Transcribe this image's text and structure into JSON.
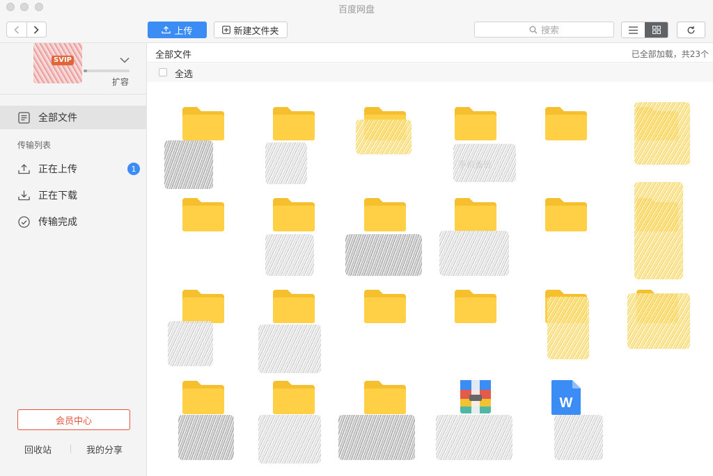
{
  "window": {
    "title": "百度网盘"
  },
  "toolbar": {
    "upload_label": "上传",
    "new_folder_label": "新建文件夹",
    "search_placeholder": "搜索"
  },
  "sidebar": {
    "vip_badge": "SVIP",
    "expand_label": "扩容",
    "all_files_label": "全部文件",
    "transfer_section_label": "传输列表",
    "transfer_items": [
      {
        "label": "正在上传",
        "icon": "upload-icon",
        "badge": "1"
      },
      {
        "label": "正在下载",
        "icon": "download-icon"
      },
      {
        "label": "传输完成",
        "icon": "check-circle-icon"
      }
    ],
    "vip_center_label": "会员中心",
    "recycle_label": "回收站",
    "my_share_label": "我的分享"
  },
  "main": {
    "breadcrumb": "全部文件",
    "load_status": "已全部加载，共23个",
    "select_all_label": "全选",
    "items": [
      {
        "type": "folder",
        "name": ""
      },
      {
        "type": "folder",
        "name": ""
      },
      {
        "type": "folder",
        "name": ""
      },
      {
        "type": "folder",
        "name": "手机备份"
      },
      {
        "type": "folder",
        "name": ""
      },
      {
        "type": "folder",
        "name": ""
      },
      {
        "type": "folder",
        "name": ""
      },
      {
        "type": "folder",
        "name": ""
      },
      {
        "type": "folder",
        "name": ""
      },
      {
        "type": "folder",
        "name": ""
      },
      {
        "type": "folder",
        "name": ""
      },
      {
        "type": "folder",
        "name": ""
      },
      {
        "type": "folder",
        "name": ""
      },
      {
        "type": "folder",
        "name": ""
      },
      {
        "type": "folder",
        "name": ""
      },
      {
        "type": "folder",
        "name": ""
      },
      {
        "type": "folder",
        "name": ""
      },
      {
        "type": "folder",
        "name": ""
      },
      {
        "type": "folder",
        "name": ""
      },
      {
        "type": "folder",
        "name": ""
      },
      {
        "type": "folder",
        "name": ""
      },
      {
        "type": "archive",
        "name": ""
      },
      {
        "type": "word-doc",
        "name": ""
      }
    ]
  },
  "colors": {
    "accent": "#3b8cf5",
    "vip": "#e5553d",
    "folder": "#ffcf45"
  }
}
